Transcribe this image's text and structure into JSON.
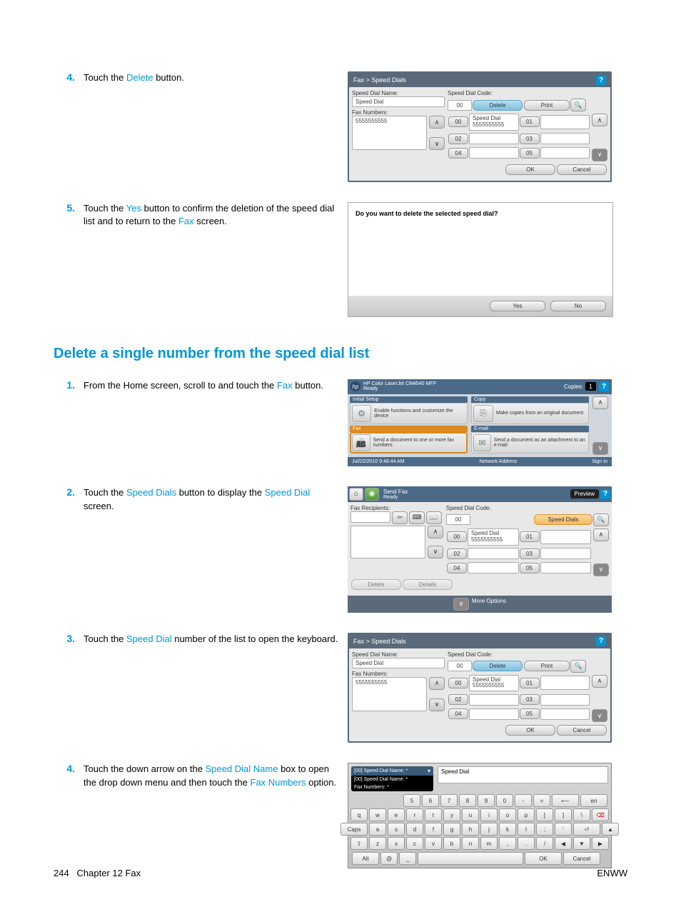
{
  "step4_pre": {
    "num": "4.",
    "text_a": "Touch the ",
    "link_a": "Delete",
    "text_b": " button."
  },
  "step5_pre": {
    "num": "5.",
    "text_a": "Touch the ",
    "link_a": "Yes",
    "text_b": " button to confirm the deletion of the speed dial list and to return to the ",
    "link_b": "Fax",
    "text_c": " screen."
  },
  "section_heading": "Delete a single number from the speed dial list",
  "step1": {
    "num": "1.",
    "text_a": "From the Home screen, scroll to and touch the ",
    "link_a": "Fax",
    "text_b": " button."
  },
  "step2": {
    "num": "2.",
    "text_a": "Touch the ",
    "link_a": "Speed Dials",
    "text_b": " button to display the ",
    "link_b": "Speed Dial",
    "text_c": " screen."
  },
  "step3": {
    "num": "3.",
    "text_a": "Touch the ",
    "link_a": "Speed Dial",
    "text_b": " number of the list to open the keyboard."
  },
  "step4": {
    "num": "4.",
    "text_a": "Touch the down arrow on the ",
    "link_a": "Speed Dial Name",
    "text_b": " box to open the drop down menu and then touch the ",
    "link_b": "Fax Numbers",
    "text_c": " option."
  },
  "footer": {
    "page": "244",
    "chapter": "Chapter 12   Fax",
    "right": "ENWW"
  },
  "speeddial_shot": {
    "title": "Fax > Speed Dials",
    "name_lbl": "Speed Dial Name:",
    "name_val": "Speed Dial",
    "numbers_lbl": "Fax Numbers:",
    "numbers_val": "5555555555",
    "code_lbl": "Speed Dial Code:",
    "code_val": "00",
    "delete": "Delete",
    "print": "Print",
    "ok": "OK",
    "cancel": "Cancel",
    "entry_lbl": "Speed Dial",
    "entry_num": "5555555555",
    "slots": [
      "00",
      "01",
      "02",
      "03",
      "04",
      "05"
    ]
  },
  "dialog_shot": {
    "message": "Do you want to delete the selected speed dial?",
    "yes": "Yes",
    "no": "No"
  },
  "home_shot": {
    "device": "HP Color LaserJet CM4540 MFP",
    "status": "Ready",
    "copies_lbl": "Copies:",
    "copies_val": "1",
    "tile_setup_h": "Initial Setup",
    "tile_setup_t": "Enable functions and customize the device",
    "tile_copy_h": "Copy",
    "tile_copy_t": "Make copies from an original document",
    "tile_fax_h": "Fax",
    "tile_fax_t": "Send a document to one or more fax numbers",
    "tile_email_h": "E-mail",
    "tile_email_t": "Send a document as an attachment to an e-mail",
    "date": "Jul/22/2010 9:48:44 AM",
    "net": "Network Address",
    "signin": "Sign In"
  },
  "sendfax_shot": {
    "title_a": "Send Fax",
    "title_b": "Ready",
    "preview": "Preview",
    "recip_lbl": "Fax Recipients:",
    "code_lbl": "Speed Dial Code:",
    "code_val": "00",
    "speed_dials": "Speed Dials",
    "entry_lbl": "Speed Dial",
    "entry_num": "5555555555",
    "slots": [
      "00",
      "01",
      "02",
      "03",
      "04",
      "05"
    ],
    "delete": "Delete",
    "details": "Details",
    "more": "More Options"
  },
  "kbd_shot": {
    "drop_a": "[00] Speed Dial Name: *",
    "drop_b": "[00] Speed Dial Name: *",
    "drop_c": "Fax Numbers: *",
    "field_val": "Speed Dial",
    "row1": [
      "5",
      "6",
      "7",
      "8",
      "9",
      "0",
      "-",
      "="
    ],
    "row2": [
      "q",
      "w",
      "e",
      "r",
      "t",
      "y",
      "u",
      "i",
      "o",
      "p",
      "[",
      "]",
      "\\"
    ],
    "row3_pre": "Caps",
    "row3": [
      "a",
      "s",
      "d",
      "f",
      "g",
      "h",
      "j",
      "k",
      "l",
      ";",
      "'"
    ],
    "row4_pre": "⇧",
    "row4": [
      "z",
      "x",
      "c",
      "v",
      "b",
      "n",
      "m",
      ",",
      ".",
      "/"
    ],
    "alt": "Alt",
    "at": "@",
    "ok": "OK",
    "cancel": "Cancel",
    "en": "en"
  }
}
